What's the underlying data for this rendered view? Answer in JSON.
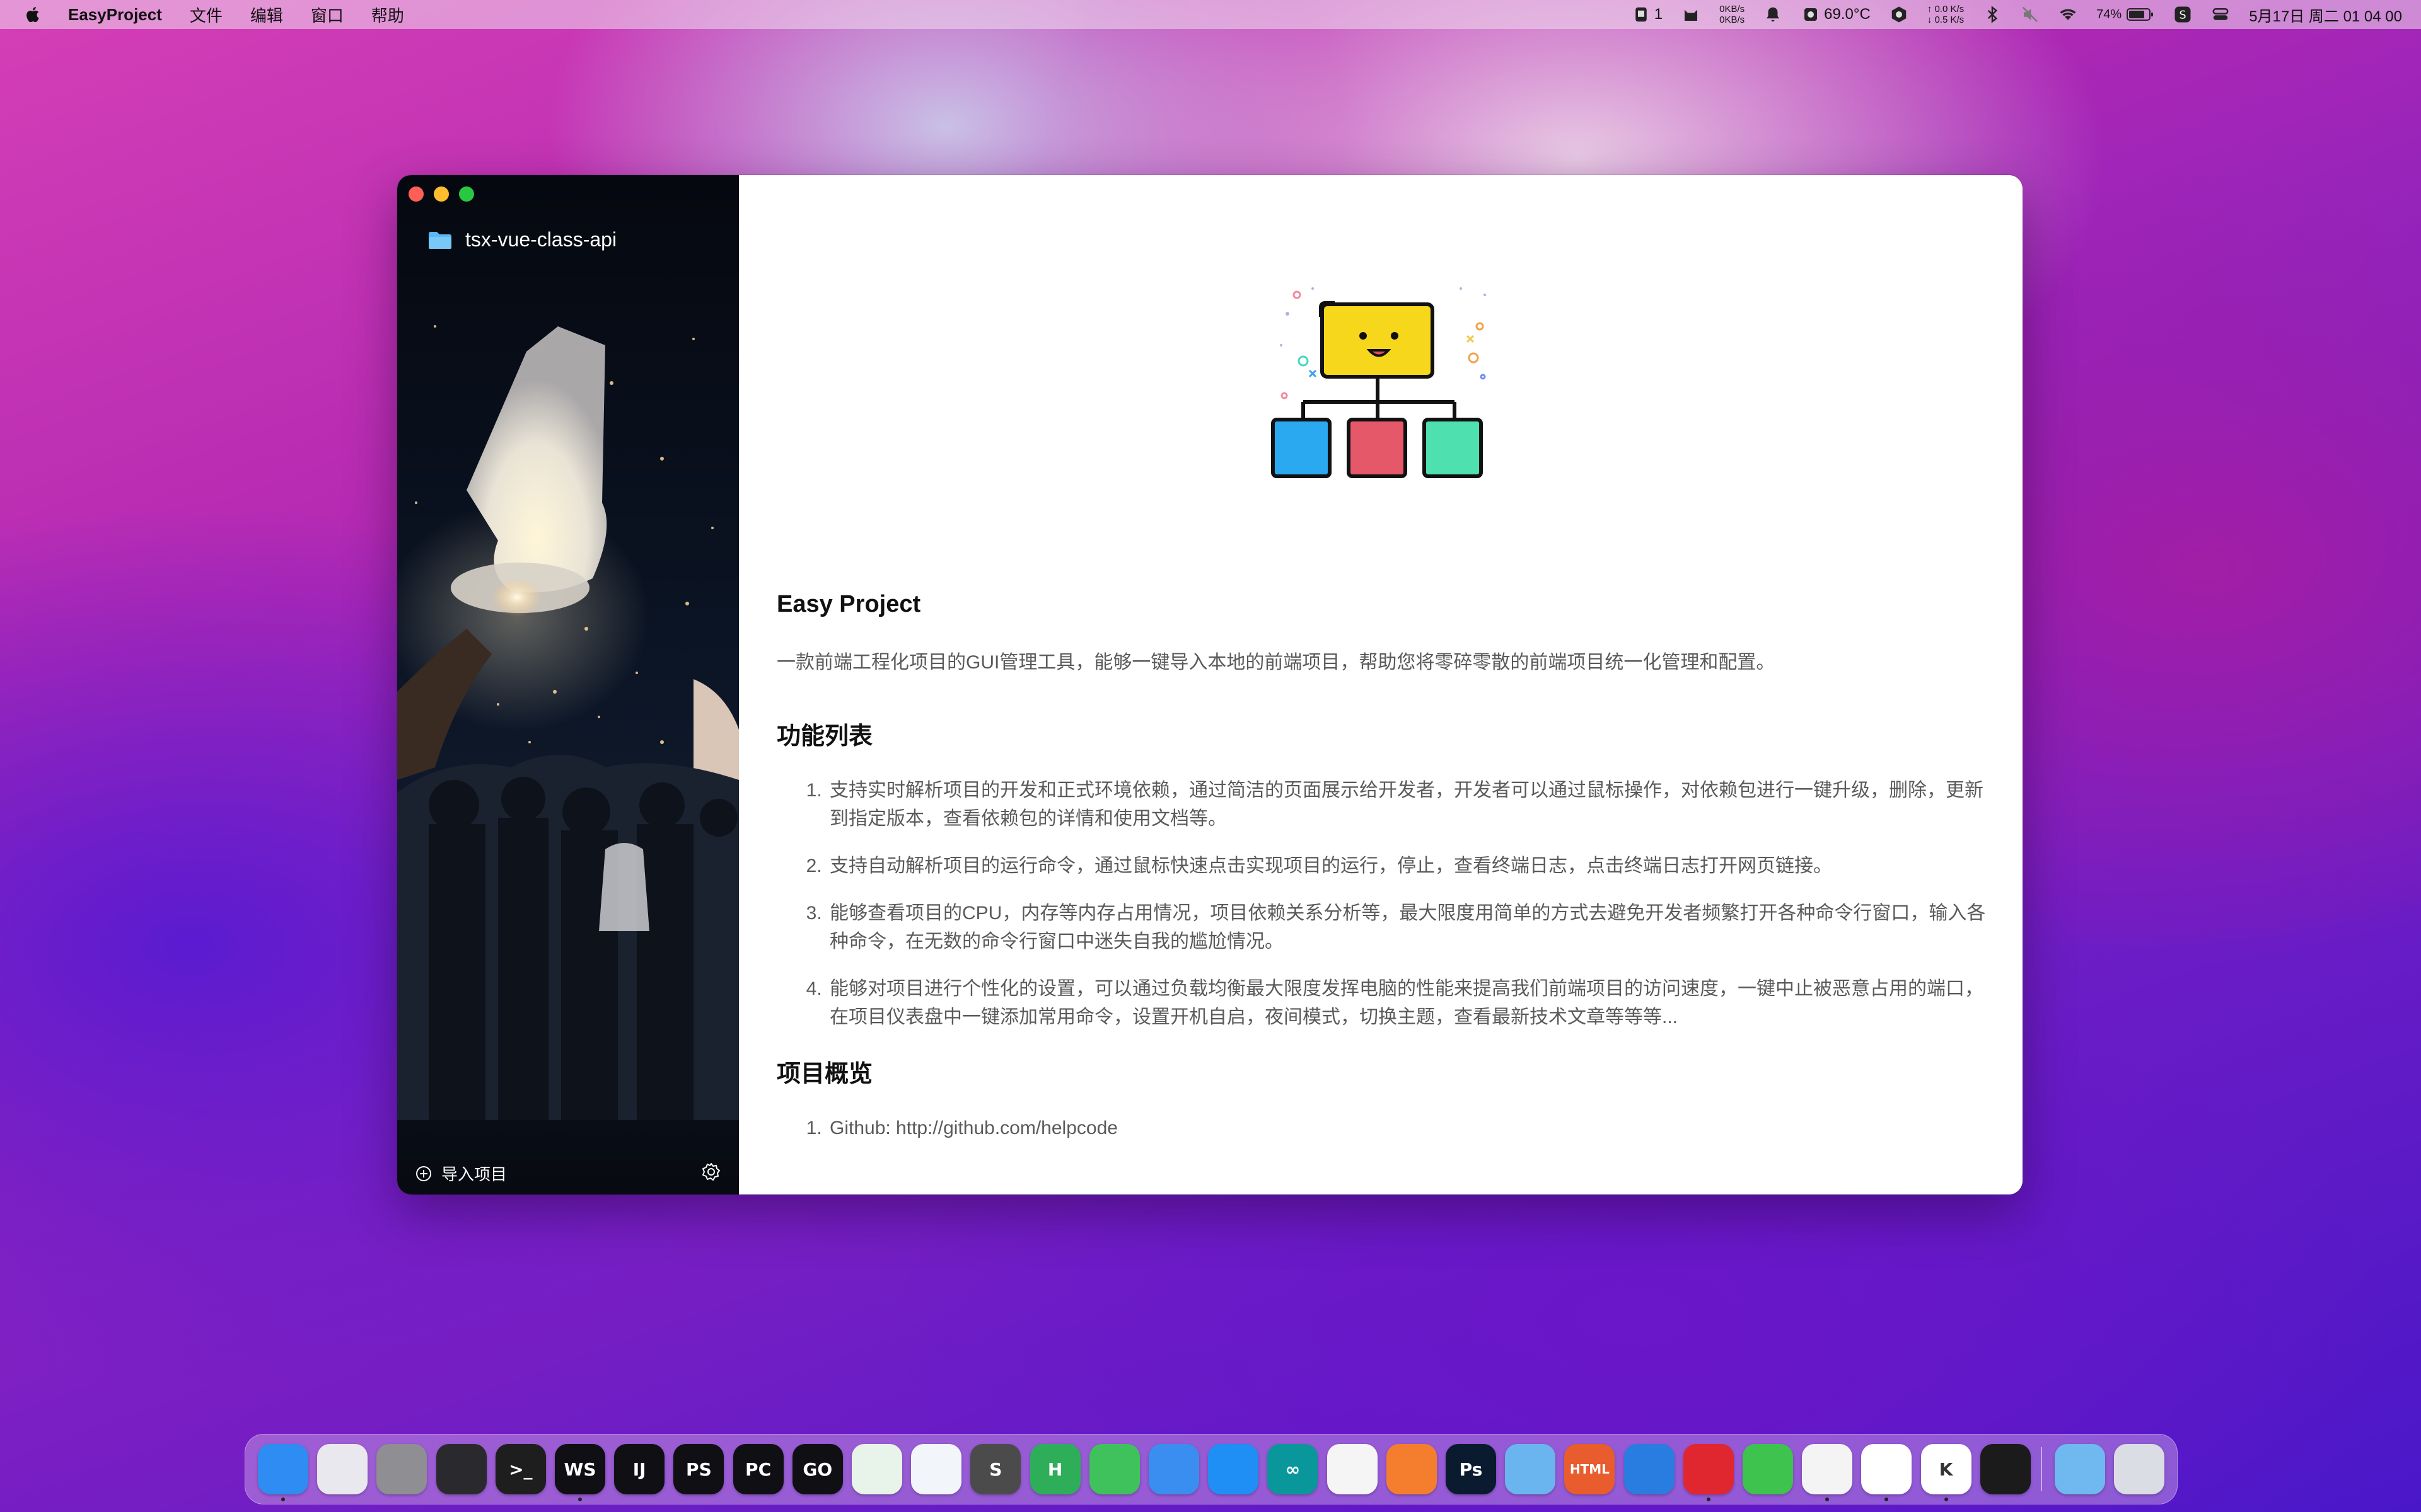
{
  "menubar": {
    "app_name": "EasyProject",
    "menus": [
      "文件",
      "编辑",
      "窗口",
      "帮助"
    ],
    "status": {
      "badge_count": "1",
      "net_up": "0KB/s",
      "net_down": "0KB/s",
      "temperature": "69.0°C",
      "speed_up": "↑ 0.0 K/s",
      "speed_down": "↓ 0.5 K/s",
      "battery": "74%",
      "datetime": "5月17日 周二  01 04 00"
    }
  },
  "sidebar": {
    "project_name": "tsx-vue-class-api",
    "import_label": "导入项目"
  },
  "content": {
    "title": "Easy Project",
    "description": "一款前端工程化项目的GUI管理工具，能够一键导入本地的前端项目，帮助您将零碎零散的前端项目统一化管理和配置。",
    "features_heading": "功能列表",
    "features": [
      "支持实时解析项目的开发和正式环境依赖，通过简洁的页面展示给开发者，开发者可以通过鼠标操作，对依赖包进行一键升级，删除，更新到指定版本，查看依赖包的详情和使用文档等。",
      "支持自动解析项目的运行命令，通过鼠标快速点击实现项目的运行，停止，查看终端日志，点击终端日志打开网页链接。",
      "能够查看项目的CPU，内存等内存占用情况，项目依赖关系分析等，最大限度用简单的方式去避免开发者频繁打开各种命令行窗口，输入各种命令，在无数的命令行窗口中迷失自我的尴尬情况。",
      "能够对项目进行个性化的设置，可以通过负载均衡最大限度发挥电脑的性能来提高我们前端项目的访问速度，一键中止被恶意占用的端口，在项目仪表盘中一键添加常用命令，设置开机自启，夜间模式，切换主题，查看最新技术文章等等等..."
    ],
    "overview_heading": "项目概览",
    "overview": [
      "Github: http://github.com/helpcode"
    ]
  },
  "dock": {
    "apps": [
      {
        "name": "finder-app",
        "label": "",
        "color": "#2f8cf2"
      },
      {
        "name": "launchpad-app",
        "label": "",
        "color": "#e8e8ee"
      },
      {
        "name": "system-preferences-app",
        "label": "",
        "color": "#8e8e93"
      },
      {
        "name": "activity-monitor-app",
        "label": "",
        "color": "#2a2a2e"
      },
      {
        "name": "terminal-app",
        "label": ">_",
        "color": "#1e1e1e"
      },
      {
        "name": "webstorm-app",
        "label": "WS",
        "color": "#0f0f14"
      },
      {
        "name": "intellij-app",
        "label": "IJ",
        "color": "#0f0f14"
      },
      {
        "name": "phpstorm-app",
        "label": "PS",
        "color": "#0f0f14"
      },
      {
        "name": "pycharm-app",
        "label": "PC",
        "color": "#0f0f14"
      },
      {
        "name": "goland-app",
        "label": "GO",
        "color": "#0f0f14"
      },
      {
        "name": "android-studio-app",
        "label": "",
        "color": "#e8f4ea"
      },
      {
        "name": "vscode-app",
        "label": "",
        "color": "#f2f6fb"
      },
      {
        "name": "sublime-text-app",
        "label": "S",
        "color": "#4b4b4b"
      },
      {
        "name": "hbuilder-app",
        "label": "H",
        "color": "#2fae5a"
      },
      {
        "name": "wechat-devtools-app",
        "label": "",
        "color": "#3fc25b"
      },
      {
        "name": "xcode-app",
        "label": "",
        "color": "#3a8ef0"
      },
      {
        "name": "app-store-app",
        "label": "",
        "color": "#1f8ff5"
      },
      {
        "name": "arduino-app",
        "label": "∞",
        "color": "#0a979b"
      },
      {
        "name": "photos-app",
        "label": "",
        "color": "#f5f5f5"
      },
      {
        "name": "pages-app",
        "label": "",
        "color": "#f57e2e"
      },
      {
        "name": "photoshop-app",
        "label": "Ps",
        "color": "#0b1b2f"
      },
      {
        "name": "database-app",
        "label": "",
        "color": "#6ab5ef"
      },
      {
        "name": "html-app",
        "label": "HTML",
        "color": "#e85c2e"
      },
      {
        "name": "cat-app",
        "label": "",
        "color": "#2a7de0"
      },
      {
        "name": "netease-music-app",
        "label": "",
        "color": "#e0262f"
      },
      {
        "name": "wechat-app",
        "label": "",
        "color": "#3ec34f"
      },
      {
        "name": "qq-app",
        "label": "",
        "color": "#f4f4f4"
      },
      {
        "name": "chrome-app",
        "label": "",
        "color": "#ffffff"
      },
      {
        "name": "kibana-app",
        "label": "K",
        "color": "#ffffff"
      },
      {
        "name": "layers-app",
        "label": "",
        "color": "#1b1b1b"
      },
      {
        "name": "folder-app",
        "label": "",
        "color": "#6fb8f0"
      },
      {
        "name": "trash-app",
        "label": "",
        "color": "#dadde4"
      }
    ],
    "running": [
      0,
      5,
      24,
      26,
      27,
      28
    ]
  }
}
